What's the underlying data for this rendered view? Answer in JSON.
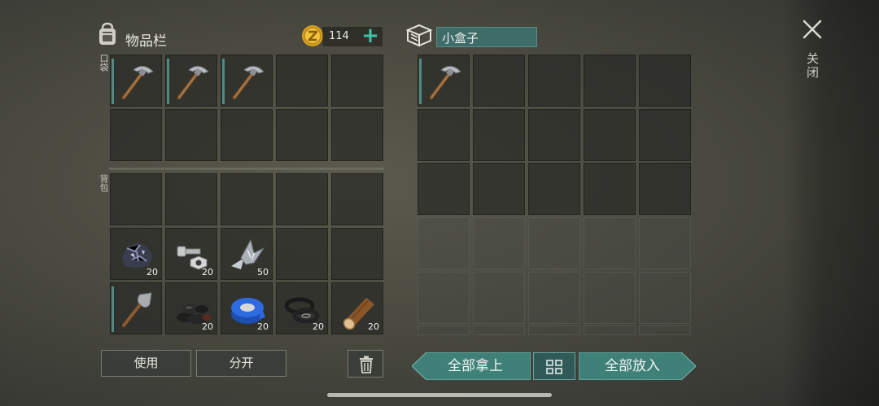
{
  "inventory": {
    "title": "物品栏",
    "pocket_label": "口袋",
    "backpack_label": "背包",
    "coins": "114",
    "pocket": [
      {
        "item": "pickaxe",
        "qty": "",
        "marked": true
      },
      {
        "item": "pickaxe",
        "qty": "",
        "marked": true
      },
      {
        "item": "pickaxe",
        "qty": "",
        "marked": true
      },
      {
        "item": "",
        "qty": "",
        "marked": false
      },
      {
        "item": "",
        "qty": "",
        "marked": false
      },
      {
        "item": "",
        "qty": "",
        "marked": false
      },
      {
        "item": "",
        "qty": "",
        "marked": false
      },
      {
        "item": "",
        "qty": "",
        "marked": false
      },
      {
        "item": "",
        "qty": "",
        "marked": false
      },
      {
        "item": "",
        "qty": "",
        "marked": false
      }
    ],
    "backpack": [
      {
        "item": "",
        "qty": "",
        "marked": false
      },
      {
        "item": "",
        "qty": "",
        "marked": false
      },
      {
        "item": "",
        "qty": "",
        "marked": false
      },
      {
        "item": "",
        "qty": "",
        "marked": false
      },
      {
        "item": "",
        "qty": "",
        "marked": false
      },
      {
        "item": "iron-ore",
        "qty": "20",
        "marked": false
      },
      {
        "item": "nuts-bolts",
        "qty": "20",
        "marked": false
      },
      {
        "item": "scrap-metal",
        "qty": "50",
        "marked": false
      },
      {
        "item": "",
        "qty": "",
        "marked": false
      },
      {
        "item": "",
        "qty": "",
        "marked": false
      },
      {
        "item": "shovel",
        "qty": "",
        "marked": true
      },
      {
        "item": "coal",
        "qty": "20",
        "marked": false
      },
      {
        "item": "duct-tape",
        "qty": "20",
        "marked": false
      },
      {
        "item": "rubber-seals",
        "qty": "20",
        "marked": false
      },
      {
        "item": "wood-log",
        "qty": "20",
        "marked": false
      }
    ],
    "use_button": "使用",
    "split_button": "分开"
  },
  "container": {
    "name": "小盒子",
    "slots": [
      {
        "item": "pickaxe",
        "qty": "",
        "marked": true
      }
    ],
    "rows_active": 3,
    "rows_locked": 3,
    "columns": 5,
    "take_all_button": "全部拿上",
    "put_all_button": "全部放入"
  },
  "close_label": "关闭",
  "colors": {
    "accent_teal": "#3fc3aa",
    "button_teal": "#3f8078",
    "slot_dark": "#2b2d29"
  },
  "icons": [
    "backpack-icon",
    "coin-icon",
    "plus-icon",
    "box-icon",
    "close-icon",
    "trash-icon",
    "grid-toggle-icon"
  ]
}
